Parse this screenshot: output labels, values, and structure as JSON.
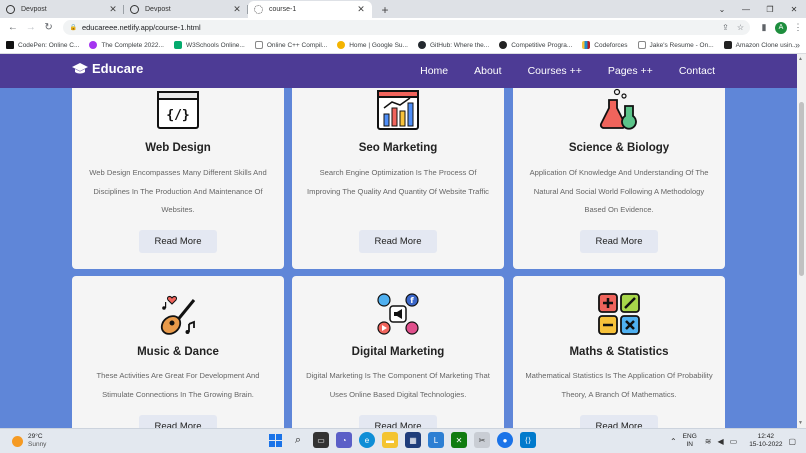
{
  "browser": {
    "tabs": [
      {
        "title": "Devpost",
        "active": false
      },
      {
        "title": "Devpost",
        "active": false
      },
      {
        "title": "course-1",
        "active": true
      }
    ],
    "new_tab_symbol": "+",
    "url": "educareee.netlify.app/course-1.html",
    "avatar_letter": "A",
    "bookmarks": [
      {
        "label": "CodePen: Online C...",
        "color": "#111111"
      },
      {
        "label": "The Complete 2022...",
        "color": "#a435f0"
      },
      {
        "label": "W3Schools Online...",
        "color": "#04aa6d"
      },
      {
        "label": "Online C++ Compil...",
        "color": "#555555"
      },
      {
        "label": "Home | Google Su...",
        "color": "#f4b400"
      },
      {
        "label": "GitHub: Where the...",
        "color": "#24292f"
      },
      {
        "label": "Competitive Progra...",
        "color": "#222222"
      },
      {
        "label": "Codeforces",
        "color": "#1f8acb"
      },
      {
        "label": "Jake's Resume - On...",
        "color": "#666666"
      },
      {
        "label": "Amazon Clone usin...",
        "color": "#222222"
      }
    ]
  },
  "site": {
    "brand": "Educare",
    "nav": [
      "Home",
      "About",
      "Courses ++",
      "Pages ++",
      "Contact"
    ],
    "cards": [
      {
        "title": "Web Design",
        "description": "Web Design Encompasses Many Different Skills And Disciplines In The Production And Maintenance Of Websites.",
        "button": "Read More",
        "icon": "web-design-icon"
      },
      {
        "title": "Seo Marketing",
        "description": "Search Engine Optimization Is The Process Of Improving The Quality And Quantity Of Website Traffic",
        "button": "Read More",
        "icon": "seo-chart-icon"
      },
      {
        "title": "Science & Biology",
        "description": "Application Of Knowledge And Understanding Of The Natural And Social World Following A Methodology Based On Evidence.",
        "button": "Read More",
        "icon": "flask-icon"
      },
      {
        "title": "Music & Dance",
        "description": "These Activities Are Great For Development And Stimulate Connections In The Growing Brain.",
        "button": "Read More",
        "icon": "guitar-icon"
      },
      {
        "title": "Digital Marketing",
        "description": "Digital Marketing Is The Component Of Marketing That Uses Online Based Digital Technologies.",
        "button": "Read More",
        "icon": "social-media-icon"
      },
      {
        "title": "Maths & Statistics",
        "description": "Mathematical Statistics Is The Application Of Probability Theory, A Branch Of Mathematics.",
        "button": "Read More",
        "icon": "math-operators-icon"
      }
    ]
  },
  "taskbar": {
    "temperature": "29°C",
    "condition": "Sunny",
    "language": "ENG",
    "region": "IN",
    "time": "12:42",
    "date": "15-10-2022"
  }
}
